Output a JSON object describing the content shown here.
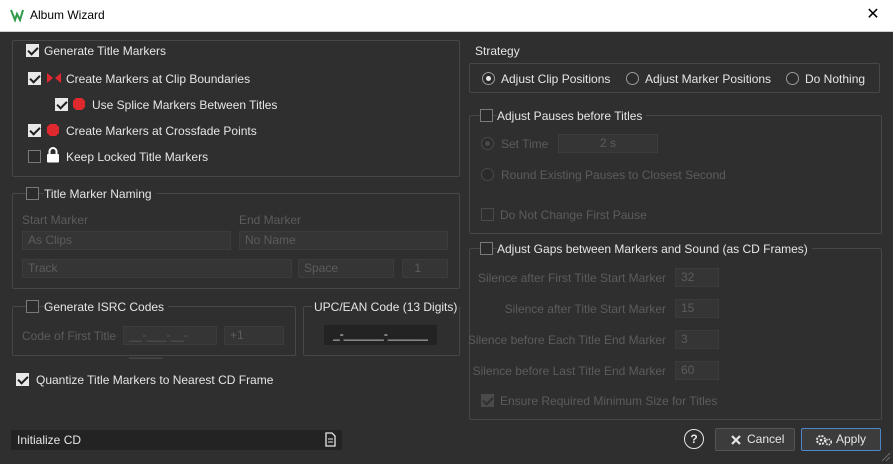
{
  "window": {
    "title": "Album Wizard",
    "close_glyph": "✕"
  },
  "title_markers": {
    "generate_label": "Generate Title Markers",
    "clip_boundaries_label": "Create Markers at Clip Boundaries",
    "splice_label": "Use Splice Markers Between Titles",
    "crossfade_label": "Create Markers at Crossfade Points",
    "keep_locked_label": "Keep Locked Title Markers"
  },
  "naming": {
    "label": "Title Marker Naming",
    "start_marker_label": "Start Marker",
    "end_marker_label": "End Marker",
    "start_marker_value": "As Clips",
    "end_marker_value": "No Name",
    "track_value": "Track",
    "space_value": "Space",
    "number_value": "1"
  },
  "isrc": {
    "label": "Generate ISRC Codes",
    "code_label": "Code of First Title",
    "code_value": "__-___-__-_____",
    "increment_value": "+1"
  },
  "upc": {
    "label": "UPC/EAN Code (13 Digits)",
    "value": "_-______-______"
  },
  "quantize_label": "Quantize Title Markers to Nearest CD Frame",
  "strategy": {
    "label": "Strategy",
    "options": [
      "Adjust Clip Positions",
      "Adjust Marker Positions",
      "Do Nothing"
    ]
  },
  "pauses": {
    "label": "Adjust Pauses before Titles",
    "set_time_label": "Set Time",
    "set_time_value": "2 s",
    "round_label": "Round Existing Pauses to Closest Second",
    "no_change_label": "Do Not Change First Pause"
  },
  "gaps": {
    "label": "Adjust Gaps between Markers and Sound (as CD Frames)",
    "rows": [
      {
        "label": "Silence after First Title Start Marker",
        "value": "32"
      },
      {
        "label": "Silence after Title Start Marker",
        "value": "15"
      },
      {
        "label": "Silence before Each Title End Marker",
        "value": "3"
      },
      {
        "label": "Silence before Last Title End Marker",
        "value": "60"
      }
    ],
    "ensure_label": "Ensure Required Minimum Size for Titles"
  },
  "preset": {
    "value": "Initialize CD"
  },
  "buttons": {
    "help": "?",
    "cancel": "Cancel",
    "apply": "Apply"
  },
  "colors": {
    "background": "#2f2f2f",
    "text": "#e6e6e6",
    "disabled_text": "#5c5c5c",
    "accent_red": "#e0282f",
    "apply_border": "#4d86c7"
  }
}
